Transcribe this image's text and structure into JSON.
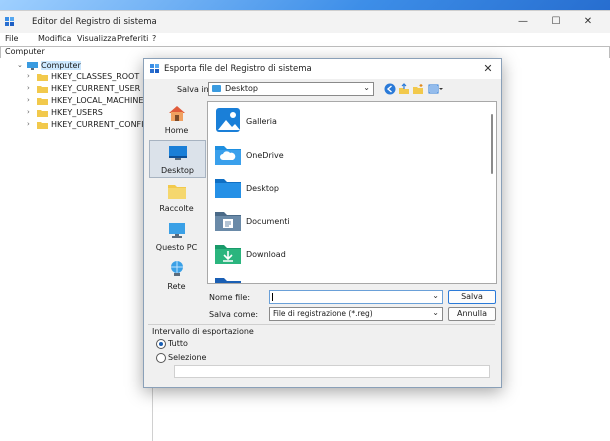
{
  "window": {
    "title": "Editor del Registro di sistema",
    "minimize": "—",
    "maximize": "☐",
    "close": "✕"
  },
  "menu": [
    "File",
    "Modifica",
    "Visualizza",
    "Preferiti",
    "?"
  ],
  "address": "Computer",
  "tree": {
    "root": "Computer",
    "items": [
      "HKEY_CLASSES_ROOT",
      "HKEY_CURRENT_USER",
      "HKEY_LOCAL_MACHINE",
      "HKEY_USERS",
      "HKEY_CURRENT_CONFIG"
    ]
  },
  "dialog": {
    "title": "Esporta file del Registro di sistema",
    "close": "✕",
    "look_in_label": "Salva in:",
    "look_in_value": "Desktop",
    "places": [
      "Home",
      "Desktop",
      "Raccolte",
      "Questo PC",
      "Rete"
    ],
    "active_place": "Desktop",
    "files": [
      "Galleria",
      "OneDrive",
      "Desktop",
      "Documenti",
      "Download"
    ],
    "filename_label": "Nome file:",
    "filename_value": "",
    "savetype_label": "Salva come:",
    "savetype_value": "File di registrazione (*.reg)",
    "save_button": "Salva",
    "cancel_button": "Annulla",
    "range_legend": "Intervallo di esportazione",
    "range_options": [
      "Tutto",
      "Selezione"
    ],
    "range_selected": "Tutto"
  },
  "colors": {
    "accent": "#2a7ad8",
    "folder": "#f2c94c",
    "selection": "#cce8ff"
  }
}
